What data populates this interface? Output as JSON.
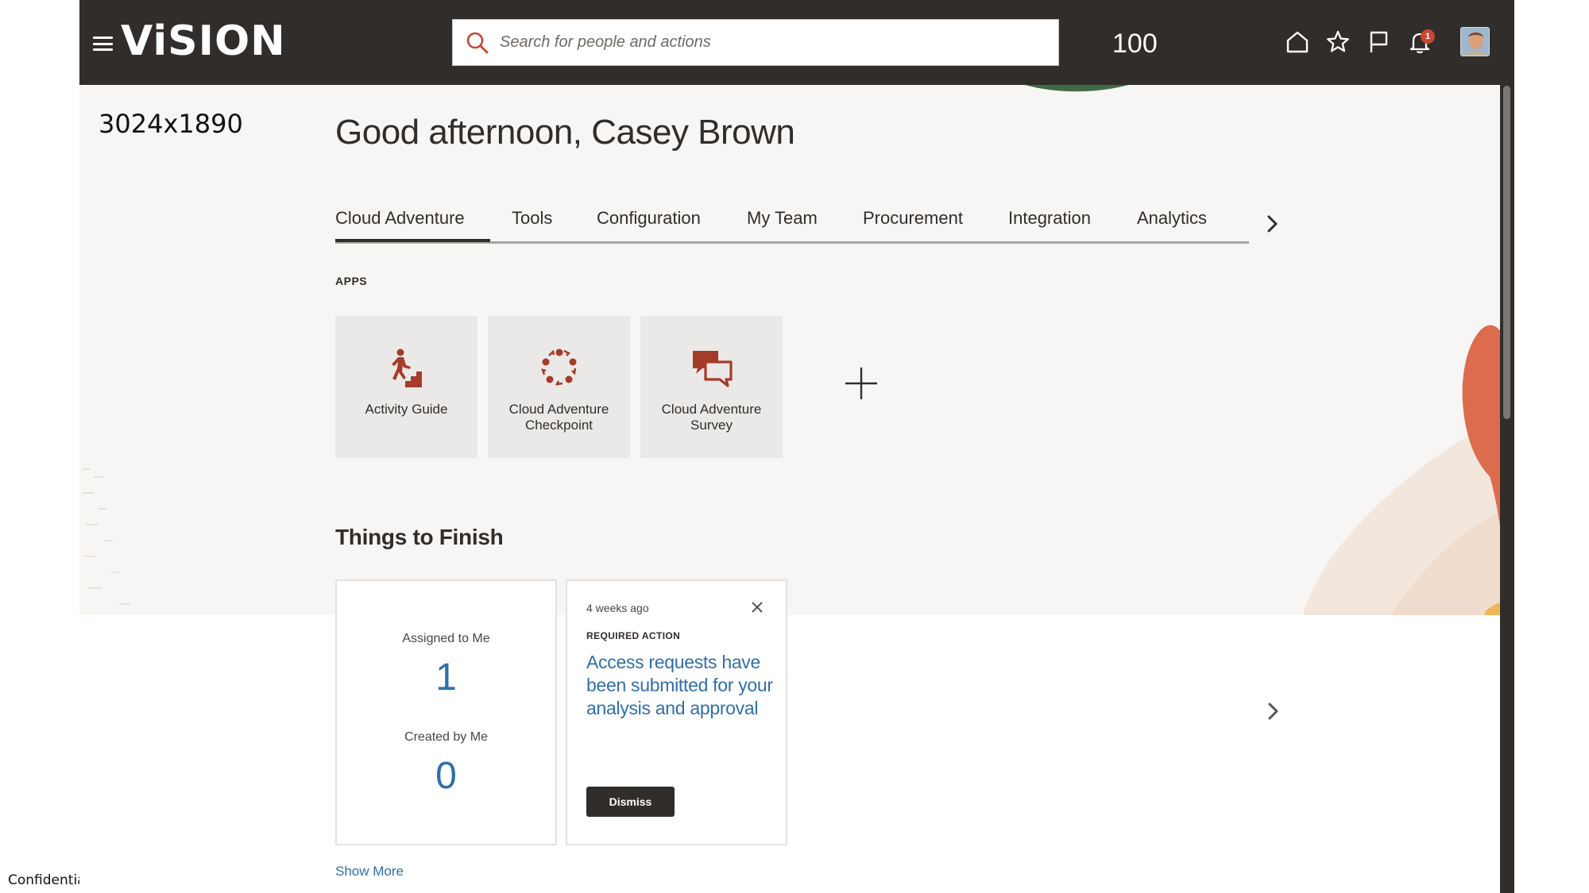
{
  "header": {
    "logo": "ViSION",
    "search_placeholder": "Search for people and actions",
    "count": "100",
    "notifications_badge": "1",
    "icons": [
      "menu-icon",
      "search-icon",
      "home-icon",
      "star-icon",
      "flag-icon",
      "bell-icon",
      "avatar"
    ]
  },
  "overlay_note": "3024x1890",
  "greeting": "Good afternoon, Casey Brown",
  "tabs": [
    {
      "label": "Cloud Adventure",
      "active": true
    },
    {
      "label": "Tools"
    },
    {
      "label": "Configuration"
    },
    {
      "label": "My Team"
    },
    {
      "label": "Procurement"
    },
    {
      "label": "Integration"
    },
    {
      "label": "Analytics"
    }
  ],
  "apps": {
    "section_label": "APPS",
    "items": [
      {
        "label": "Activity Guide",
        "icon": "activity-guide-icon"
      },
      {
        "label": "Cloud Adventure Checkpoint",
        "icon": "checkpoint-icon"
      },
      {
        "label": "Cloud Adventure Survey",
        "icon": "survey-icon"
      }
    ]
  },
  "things_to_finish": {
    "title": "Things to Finish",
    "assigned_label": "Assigned to Me",
    "assigned_value": "1",
    "created_label": "Created by Me",
    "created_value": "0",
    "action_card": {
      "time": "4 weeks ago",
      "kind": "REQUIRED ACTION",
      "title": "Access requests have been submitted for your analysis and approval",
      "dismiss_label": "Dismiss"
    },
    "show_more": "Show More"
  },
  "footer": {
    "confidential": "Confidential"
  },
  "colors": {
    "header_bg": "#312d2a",
    "accent": "#c74634",
    "link": "#2f6fa8",
    "page_bg": "#f8f6f4"
  }
}
